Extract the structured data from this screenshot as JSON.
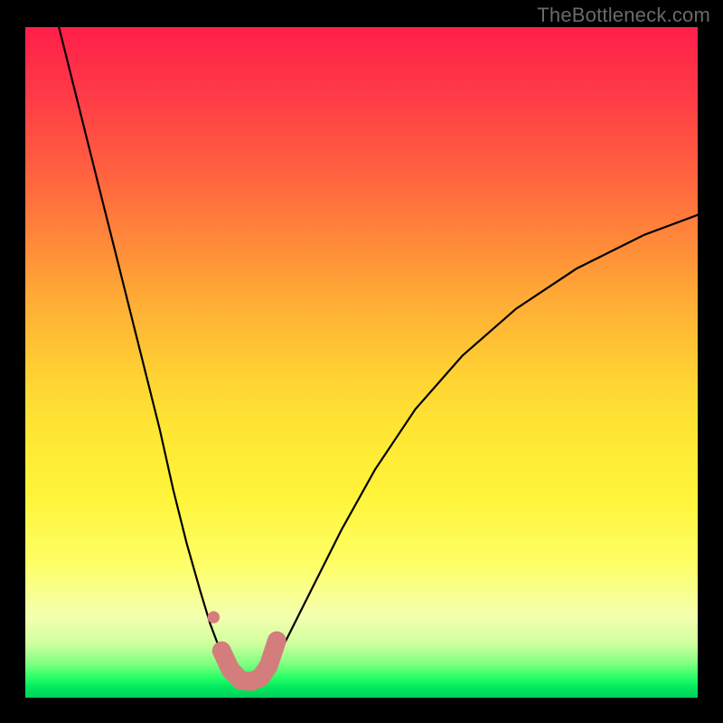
{
  "watermark": "TheBottleneck.com",
  "chart_data": {
    "type": "line",
    "title": "",
    "xlabel": "",
    "ylabel": "",
    "xlim": [
      0,
      100
    ],
    "ylim": [
      0,
      100
    ],
    "grid": false,
    "series": [
      {
        "name": "curve",
        "color": "#000000",
        "x": [
          5,
          8,
          11,
          14,
          17,
          20,
          22,
          24,
          26,
          27.5,
          29,
          30,
          31,
          32,
          33,
          34,
          36,
          38,
          40,
          43,
          47,
          52,
          58,
          65,
          73,
          82,
          92,
          100
        ],
        "y": [
          100,
          88,
          76,
          64,
          52,
          40,
          31,
          23,
          16,
          11,
          7,
          4.5,
          2.8,
          2.0,
          2.0,
          2.5,
          4.0,
          7,
          11,
          17,
          25,
          34,
          43,
          51,
          58,
          64,
          69,
          72
        ]
      }
    ],
    "markers": [
      {
        "name": "marker-left-dot",
        "color": "#d47d7d",
        "x": 28.0,
        "y": 12.0,
        "r": 1.0
      },
      {
        "name": "marker-valley-blob",
        "color": "#d47d7d",
        "path_x": [
          29.2,
          30.5,
          32.0,
          33.5,
          35.0,
          36.2,
          37.4
        ],
        "path_y": [
          7.0,
          4.2,
          2.6,
          2.4,
          3.0,
          4.8,
          8.5
        ],
        "width": 2.8
      }
    ],
    "background": {
      "type": "vertical-gradient",
      "stops": [
        {
          "pos": 0,
          "color": "#ff1f4a"
        },
        {
          "pos": 0.4,
          "color": "#ffa936"
        },
        {
          "pos": 0.7,
          "color": "#fff43a"
        },
        {
          "pos": 0.92,
          "color": "#cfff9d"
        },
        {
          "pos": 1.0,
          "color": "#00d059"
        }
      ]
    }
  }
}
